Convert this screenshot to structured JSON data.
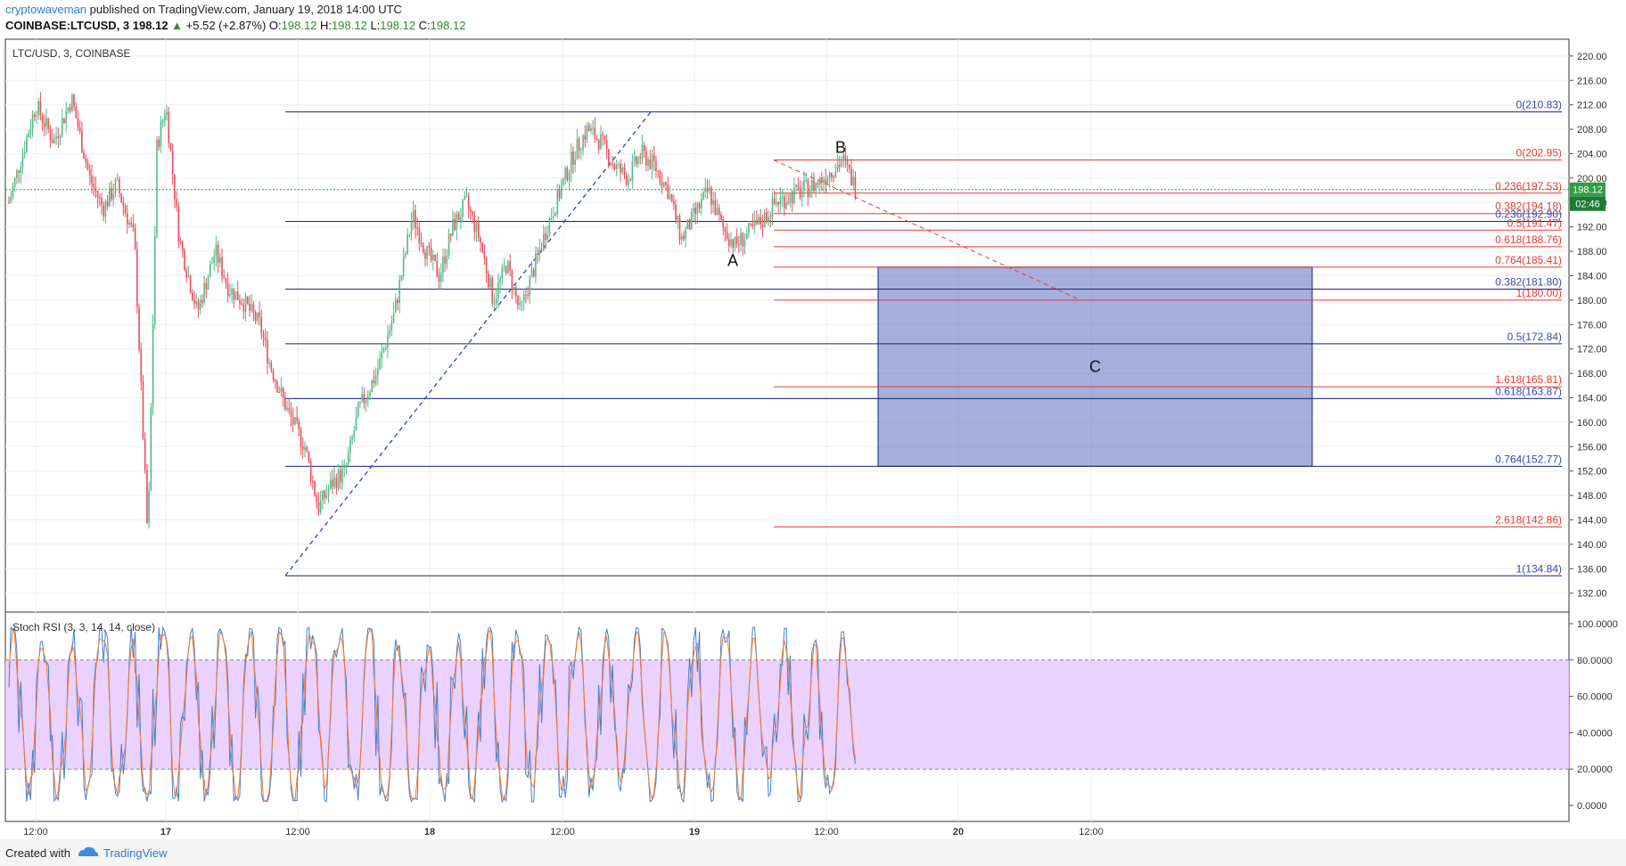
{
  "header": {
    "author": "cryptowaveman",
    "published": "published on TradingView.com, January 19, 2018 14:00 UTC",
    "symbol": "COINBASE:LTCUSD, 3",
    "last": "198.12",
    "change_arrow": "▲",
    "change": "+5.52 (+2.87%)",
    "o_label": "O:",
    "o_value": "198.12",
    "h_label": "H:",
    "h_value": "198.12",
    "l_label": "L:",
    "l_value": "198.12",
    "c_label": "C:",
    "c_value": "198.12"
  },
  "footer": {
    "created_with": "Created with",
    "brand": "TradingView"
  },
  "colors": {
    "up": "#53b987",
    "down": "#eb4d5c",
    "blue_fib": "#1a237e",
    "red_fib": "#e53935",
    "zone": "#5c6bc0",
    "rsi_blue": "#3f7fd6",
    "rsi_orange": "#f57c2a",
    "rsi_band": "#e8ccff",
    "current_price": "#2f9e44"
  },
  "chart_data": [
    {
      "type": "candlestick",
      "title": "LTC/USD, 3, COINBASE",
      "ylim": [
        130.5,
        221
      ],
      "y_ticks": [
        "220.00",
        "216.00",
        "212.00",
        "208.00",
        "204.00",
        "200.00",
        "196.00",
        "192.00",
        "188.00",
        "184.00",
        "180.00",
        "176.00",
        "172.00",
        "168.00",
        "164.00",
        "160.00",
        "156.00",
        "152.00",
        "148.00",
        "144.00",
        "140.00",
        "136.00",
        "132.00"
      ],
      "x_ticks": [
        "12:00",
        "17",
        "12:00",
        "18",
        "12:00",
        "19",
        "12:00",
        "20",
        "12:00"
      ],
      "price_path": [
        [
          0,
          196
        ],
        [
          3,
          212
        ],
        [
          5,
          206
        ],
        [
          7,
          213
        ],
        [
          9,
          200
        ],
        [
          10.5,
          195
        ],
        [
          12,
          199
        ],
        [
          14,
          190
        ],
        [
          15.5,
          140
        ],
        [
          16.5,
          205
        ],
        [
          17.5,
          212
        ],
        [
          19,
          190
        ],
        [
          21,
          178
        ],
        [
          23,
          188
        ],
        [
          24.5,
          182
        ],
        [
          26,
          180
        ],
        [
          28,
          176
        ],
        [
          29,
          170
        ],
        [
          31,
          162
        ],
        [
          33,
          156
        ],
        [
          34.5,
          146
        ],
        [
          36,
          150
        ],
        [
          37.5,
          152
        ],
        [
          39,
          162
        ],
        [
          41,
          168
        ],
        [
          43,
          178
        ],
        [
          45,
          194
        ],
        [
          46.5,
          188
        ],
        [
          48,
          184
        ],
        [
          49.5,
          192
        ],
        [
          51,
          196
        ],
        [
          52.5,
          190
        ],
        [
          54,
          180
        ],
        [
          55.5,
          186
        ],
        [
          57,
          178
        ],
        [
          58.5,
          185
        ],
        [
          60,
          192
        ],
        [
          61.5,
          198
        ],
        [
          63,
          204
        ],
        [
          64.5,
          208
        ],
        [
          66,
          206
        ],
        [
          67.5,
          202
        ],
        [
          69,
          200
        ],
        [
          70.5,
          204
        ],
        [
          72,
          202
        ],
        [
          73.5,
          198
        ],
        [
          75,
          190
        ],
        [
          76.5,
          194
        ],
        [
          78,
          198
        ],
        [
          79.5,
          192
        ],
        [
          81,
          189
        ],
        [
          82.5,
          191
        ],
        [
          84,
          193
        ],
        [
          85.5,
          196
        ],
        [
          87,
          197
        ],
        [
          88.5,
          198
        ],
        [
          90,
          199
        ],
        [
          91.5,
          201
        ],
        [
          93,
          203
        ],
        [
          94.5,
          198.12
        ]
      ],
      "current_price": "198.12",
      "current_tag": "02:46",
      "fib_blue": [
        {
          "label": "0(210.83)",
          "value": 210.83
        },
        {
          "label": "0.236(192.90)",
          "value": 192.9
        },
        {
          "label": "0.382(181.80)",
          "value": 181.8
        },
        {
          "label": "0.5(172.84)",
          "value": 172.84
        },
        {
          "label": "0.618(163.87)",
          "value": 163.87
        },
        {
          "label": "0.764(152.77)",
          "value": 152.77
        },
        {
          "label": "1(134.84)",
          "value": 134.84
        }
      ],
      "fib_red": [
        {
          "label": "0(202.95)",
          "value": 202.95
        },
        {
          "label": "0.236(197.53)",
          "value": 197.53
        },
        {
          "label": "0.382(194.18)",
          "value": 194.18
        },
        {
          "label": "0.5(191.47)",
          "value": 191.47
        },
        {
          "label": "0.618(188.76)",
          "value": 188.76
        },
        {
          "label": "0.764(185.41)",
          "value": 185.41
        },
        {
          "label": "1(180.00)",
          "value": 180.0
        },
        {
          "label": "1.618(165.81)",
          "value": 165.81
        },
        {
          "label": "2.618(142.86)",
          "value": 142.86
        }
      ],
      "target_zone": {
        "label": "C",
        "top": 185.41,
        "bottom": 152.77
      },
      "wave_labels": [
        {
          "label": "A",
          "value": 186.5
        },
        {
          "label": "B",
          "value": 205.0
        }
      ]
    },
    {
      "type": "line",
      "title": "Stoch RSI (3, 3, 14, 14, close)",
      "ylim": [
        0,
        100
      ],
      "y_ticks": [
        "100.0000",
        "80.0000",
        "60.0000",
        "40.0000",
        "20.0000",
        "0.0000"
      ],
      "bands": [
        20,
        80
      ],
      "series": [
        {
          "name": "K",
          "color": "#3f7fd6"
        },
        {
          "name": "D",
          "color": "#f57c2a"
        }
      ]
    }
  ]
}
